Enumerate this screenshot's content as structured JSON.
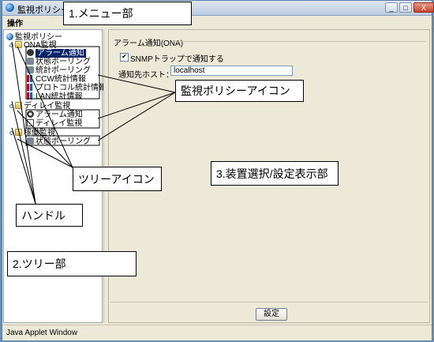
{
  "window": {
    "title": "監視ポリシー",
    "buttons": [
      "_",
      "□",
      "X"
    ]
  },
  "menu": {
    "item": "操作"
  },
  "tree": {
    "root": "監視ポリシー",
    "groups": [
      {
        "label": "ONA監視",
        "children": [
          "アラーム通知",
          "状態ポーリング",
          "統計ポーリング",
          "CCW統計情報",
          "プロトコル統計情報",
          "LAN統計情報"
        ]
      },
      {
        "label": "ディレイ監視",
        "children": [
          "アラーム通知",
          "ディレイ監視"
        ]
      },
      {
        "label": "稼働監視",
        "children": [
          "状態ポーリング"
        ]
      }
    ]
  },
  "detail": {
    "section_title": "アラーム通知(ONA)",
    "checkbox_label": "SNMPトラップで通知する",
    "checkbox_checked": true,
    "host_label": "通知先ホスト：",
    "host_value": "localhost",
    "ok_button": "設定"
  },
  "status": {
    "text": "Java Applet Window"
  },
  "callouts": {
    "menu": "1.メニュー部",
    "policy_icon": "監視ポリシーアイコン",
    "tree_icon": "ツリーアイコン",
    "device": "3.装置選択/設定表示部",
    "handle": "ハンドル",
    "tree": "2.ツリー部"
  }
}
